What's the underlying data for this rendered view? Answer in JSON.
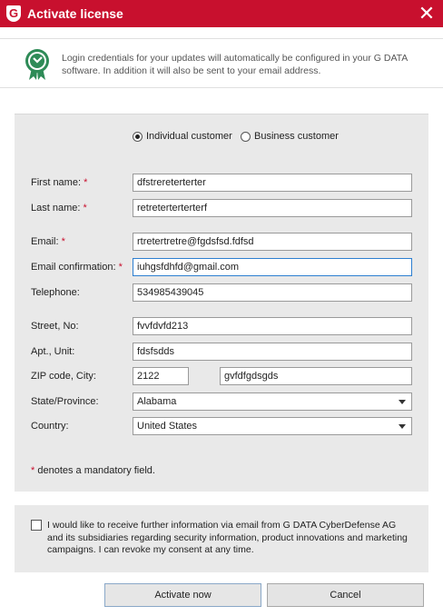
{
  "window": {
    "title": "Activate license",
    "logo_letter": "G",
    "close_glyph": "✕"
  },
  "info": {
    "text": "Login credentials for your updates will automatically be configured in your G DATA software. In addition it will also be sent to your email address."
  },
  "customer_type": {
    "individual_label": "Individual customer",
    "business_label": "Business customer",
    "selected": "individual"
  },
  "fields": {
    "first_name": {
      "label": "First name:",
      "required": "*",
      "value": "dfstrereterterter"
    },
    "last_name": {
      "label": "Last name:",
      "required": "*",
      "value": "retreterterterterf"
    },
    "email": {
      "label": "Email:",
      "required": "*",
      "value": "rtretertretre@fgdsfsd.fdfsd"
    },
    "email_confirmation": {
      "label": "Email confirmation:",
      "required": "*",
      "value": "iuhgsfdhfd@gmail.com"
    },
    "telephone": {
      "label": "Telephone:",
      "value": "534985439045"
    },
    "street": {
      "label": "Street, No:",
      "value": "fvvfdvfd213"
    },
    "apt": {
      "label": "Apt., Unit:",
      "value": "fdsfsdds"
    },
    "zip_city": {
      "label": "ZIP code, City:",
      "zip": "2122",
      "city": "gvfdfgdsgds"
    },
    "state": {
      "label": "State/Province:",
      "value": "Alabama"
    },
    "country": {
      "label": "Country:",
      "value": "United States"
    }
  },
  "mandatory_note": {
    "asterisk": "*",
    "text": "denotes a mandatory field."
  },
  "consent": {
    "checked": false,
    "text": "I would like to receive further information via email from G DATA CyberDefense AG and its subsidiaries regarding security information, product innovations and marketing campaigns. I can revoke my consent at any time."
  },
  "buttons": {
    "activate": "Activate now",
    "cancel": "Cancel"
  },
  "colors": {
    "brand": "#c8102e",
    "focus": "#2d7fd0"
  }
}
